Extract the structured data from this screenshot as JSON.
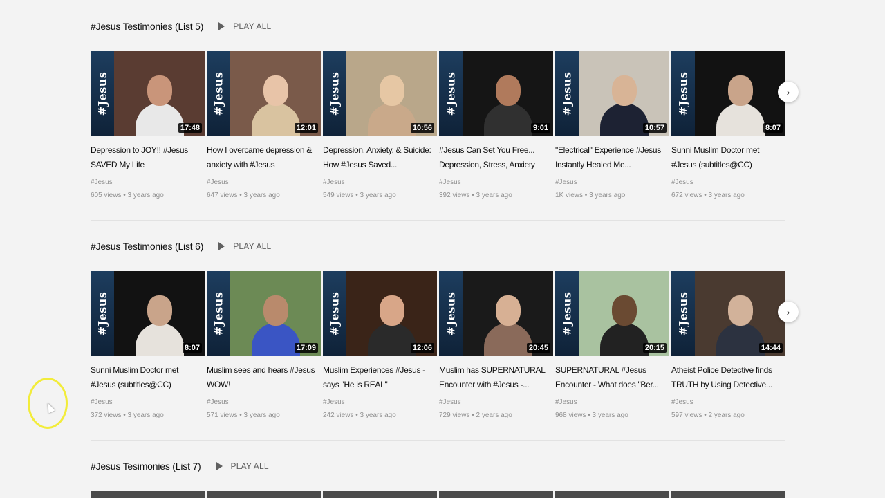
{
  "thumb_banner_text": "#Jesus",
  "play_all_label": "PLAY ALL",
  "next_glyph": "›",
  "shelves": [
    {
      "title": "#Jesus Testimonies (List 5)",
      "videos": [
        {
          "title": "Depression to JOY!! #Jesus SAVED My Life",
          "duration": "17:48",
          "channel": "#Jesus",
          "stats": "605 views • 3 years ago",
          "bg": "#5a3c32",
          "skin": "#c9957a",
          "shirt": "#e8e8e8"
        },
        {
          "title": "How I overcame depression & anxiety with #Jesus",
          "duration": "12:01",
          "channel": "#Jesus",
          "stats": "647 views • 3 years ago",
          "bg": "#7a5a4a",
          "skin": "#e8c4a8",
          "shirt": "#d9c3a0"
        },
        {
          "title": "Depression, Anxiety, & Suicide: How #Jesus Saved...",
          "duration": "10:56",
          "channel": "#Jesus",
          "stats": "549 views • 3 years ago",
          "bg": "#b9a78a",
          "skin": "#e6c7a4",
          "shirt": "#c9a98a"
        },
        {
          "title": "#Jesus Can Set You Free... Depression, Stress, Anxiety",
          "duration": "9:01",
          "channel": "#Jesus",
          "stats": "392 views • 3 years ago",
          "bg": "#151515",
          "skin": "#b07a5c",
          "shirt": "#303030"
        },
        {
          "title": "\"Electrical\" Experience #Jesus Instantly Healed Me...",
          "duration": "10:57",
          "channel": "#Jesus",
          "stats": "1K views • 3 years ago",
          "bg": "#c9c3b8",
          "skin": "#d8b496",
          "shirt": "#1d2233"
        },
        {
          "title": "Sunni Muslim Doctor met #Jesus (subtitles@CC)",
          "duration": "8:07",
          "channel": "#Jesus",
          "stats": "672 views • 3 years ago",
          "bg": "#121212",
          "skin": "#c9a48a",
          "shirt": "#e6e2dc"
        }
      ]
    },
    {
      "title": "#Jesus Testimonies (List 6)",
      "videos": [
        {
          "title": "Sunni Muslim Doctor met #Jesus (subtitles@CC)",
          "duration": "8:07",
          "channel": "#Jesus",
          "stats": "372 views • 3 years ago",
          "bg": "#121212",
          "skin": "#c9a48a",
          "shirt": "#e6e2dc"
        },
        {
          "title": "Muslim sees and hears #Jesus WOW!",
          "duration": "17:09",
          "channel": "#Jesus",
          "stats": "571 views • 3 years ago",
          "bg": "#6c8a55",
          "skin": "#b98a6c",
          "shirt": "#3a55c4"
        },
        {
          "title": "Muslim Experiences #Jesus - says \"He is REAL\"",
          "duration": "12:06",
          "channel": "#Jesus",
          "stats": "242 views • 3 years ago",
          "bg": "#3a2418",
          "skin": "#d8a688",
          "shirt": "#2a2a2a"
        },
        {
          "title": "Muslim has SUPERNATURAL Encounter with #Jesus -...",
          "duration": "20:45",
          "channel": "#Jesus",
          "stats": "729 views • 2 years ago",
          "bg": "#1a1a1a",
          "skin": "#d7b094",
          "shirt": "#8a6a5a"
        },
        {
          "title": "SUPERNATURAL #Jesus Encounter - What does \"Ber...",
          "duration": "20:15",
          "channel": "#Jesus",
          "stats": "968 views • 3 years ago",
          "bg": "#a9c2a0",
          "skin": "#6a4a32",
          "shirt": "#222222"
        },
        {
          "title": "Atheist Police Detective finds TRUTH by Using Detective...",
          "duration": "14:44",
          "channel": "#Jesus",
          "stats": "597 views • 2 years ago",
          "bg": "#4a3a30",
          "skin": "#d2b29a",
          "shirt": "#2c3240"
        }
      ]
    },
    {
      "title": "#Jesus Tesimonies (List 7)"
    }
  ]
}
